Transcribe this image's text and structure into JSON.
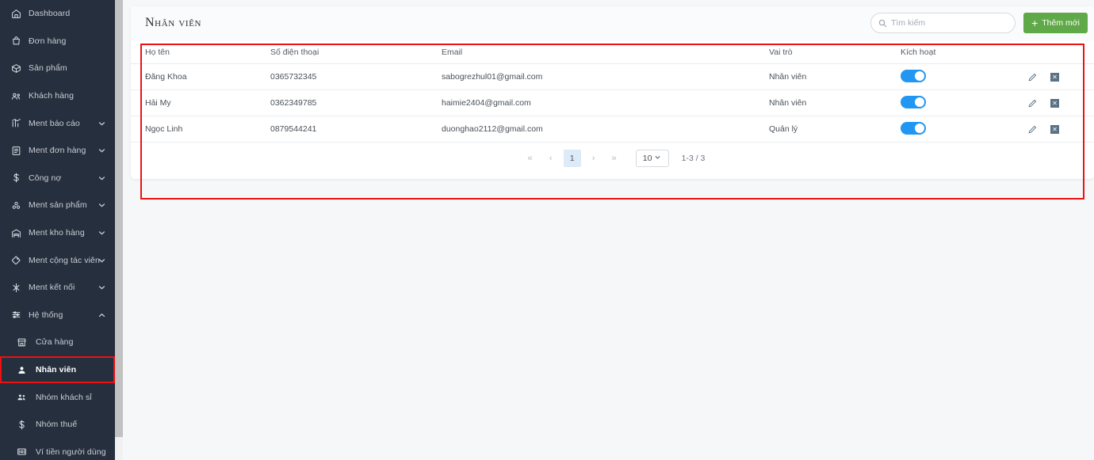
{
  "sidebar": {
    "items": [
      {
        "label": "Dashboard",
        "icon": "home-icon",
        "expandable": false,
        "sub": false
      },
      {
        "label": "Đơn hàng",
        "icon": "bag-icon",
        "expandable": false,
        "sub": false
      },
      {
        "label": "Sản phẩm",
        "icon": "box-icon",
        "expandable": false,
        "sub": false
      },
      {
        "label": "Khách hàng",
        "icon": "people-icon",
        "expandable": false,
        "sub": false
      },
      {
        "label": "Ment báo cáo",
        "icon": "chart-icon",
        "expandable": true,
        "sub": false
      },
      {
        "label": "Ment đơn hàng",
        "icon": "list-icon",
        "expandable": true,
        "sub": false
      },
      {
        "label": "Công nợ",
        "icon": "dollar-icon",
        "expandable": true,
        "sub": false
      },
      {
        "label": "Ment sản phẩm",
        "icon": "cubes-icon",
        "expandable": true,
        "sub": false
      },
      {
        "label": "Ment kho hàng",
        "icon": "warehouse-icon",
        "expandable": true,
        "sub": false
      },
      {
        "label": "Ment cộng tác viên",
        "icon": "tag-icon",
        "expandable": true,
        "sub": false
      },
      {
        "label": "Ment kết nối",
        "icon": "network-icon",
        "expandable": true,
        "sub": false
      },
      {
        "label": "Hệ thống",
        "icon": "sliders-icon",
        "expandable": true,
        "sub": false,
        "expanded": true
      },
      {
        "label": "Cửa hàng",
        "icon": "store-icon",
        "expandable": false,
        "sub": true
      },
      {
        "label": "Nhân viên",
        "icon": "user-icon",
        "expandable": false,
        "sub": true,
        "selected": true
      },
      {
        "label": "Nhóm khách sỉ",
        "icon": "group-icon",
        "expandable": false,
        "sub": true
      },
      {
        "label": "Nhóm thuế",
        "icon": "dollar-icon",
        "expandable": false,
        "sub": true
      },
      {
        "label": "Ví tiền người dùng",
        "icon": "wallet-icon",
        "expandable": false,
        "sub": true
      }
    ]
  },
  "header": {
    "title": "Nhân viên",
    "search_placeholder": "Tìm kiếm",
    "search_value": "",
    "add_label": "Thêm mới"
  },
  "table": {
    "columns": [
      "Họ tên",
      "Số điện thoại",
      "Email",
      "Vai trò",
      "Kích hoạt",
      ""
    ],
    "rows": [
      {
        "name": "Đăng Khoa",
        "phone": "0365732345",
        "email": "sabogrezhul01@gmail.com",
        "role": "Nhân viên",
        "active": true
      },
      {
        "name": "Hải My",
        "phone": "0362349785",
        "email": "haimie2404@gmail.com",
        "role": "Nhân viên",
        "active": true
      },
      {
        "name": "Ngọc Linh",
        "phone": "0879544241",
        "email": "duonghao2112@gmail.com",
        "role": "Quản lý",
        "active": true
      }
    ]
  },
  "pagination": {
    "first": "«",
    "prev": "‹",
    "current_page": "1",
    "next": "›",
    "last": "»",
    "page_size": "10",
    "range_text": "1-3 / 3"
  },
  "colors": {
    "sidebar_bg": "#262f3d",
    "accent_green": "#60a948",
    "toggle_blue": "#2196f3",
    "annotation_red": "#ee1111",
    "page_bg": "#f6f7f9"
  }
}
